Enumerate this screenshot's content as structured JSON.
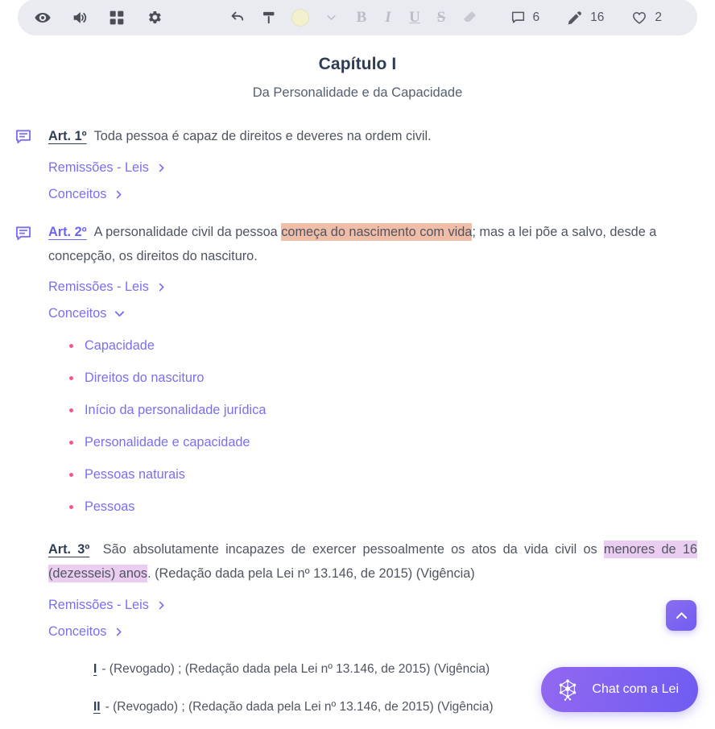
{
  "toolbar": {
    "left_tools": [
      {
        "name": "eye-icon",
        "label": "Visualizar"
      },
      {
        "name": "speaker-icon",
        "label": "Ouvir"
      },
      {
        "name": "grid-icon",
        "label": "Blocos"
      },
      {
        "name": "gear-icon",
        "label": "Configurações"
      }
    ],
    "mid_tools": [
      {
        "name": "undo-icon",
        "label": "Desfazer"
      },
      {
        "name": "paint-roller-icon",
        "label": "Marcador"
      }
    ],
    "color_swatch": {
      "name": "color-swatch",
      "color": "#f2f0cd"
    },
    "format_tools": [
      {
        "name": "bold-button",
        "label": "B"
      },
      {
        "name": "italic-button",
        "label": "I"
      },
      {
        "name": "underline-button",
        "label": "U"
      },
      {
        "name": "strikethrough-button",
        "label": "S"
      },
      {
        "name": "eraser-icon",
        "label": "Apagar"
      }
    ],
    "counters": [
      {
        "name": "comments-counter",
        "icon": "comment-icon",
        "value": "6"
      },
      {
        "name": "highlights-counter",
        "icon": "marker-pen-icon",
        "value": "16"
      },
      {
        "name": "favorites-counter",
        "icon": "heart-icon",
        "value": "2"
      }
    ]
  },
  "document": {
    "chapter_title": "Capítulo I",
    "chapter_subtitle": "Da Personalidade e da Capacidade",
    "articles": [
      {
        "label": "Art. 1º",
        "text": "Toda pessoa é capaz de direitos e deveres na ordem civil.",
        "links": [
          {
            "label": "Remissões - Leis",
            "state": "collapsed"
          },
          {
            "label": "Conceitos",
            "state": "collapsed"
          }
        ]
      },
      {
        "label": "Art. 2º",
        "text_pre": "A personalidade civil da pessoa ",
        "text_highlight": "começa do nascimento com vida",
        "text_post": "; mas a lei põe a salvo, desde a concepção, os direitos do nascituro.",
        "links": [
          {
            "label": "Remissões - Leis",
            "state": "collapsed"
          },
          {
            "label": "Conceitos",
            "state": "expanded"
          }
        ],
        "concepts": [
          "Capacidade",
          "Direitos do nascituro",
          "Início da personalidade jurídica",
          "Personalidade e capacidade",
          "Pessoas naturais",
          "Pessoas"
        ]
      },
      {
        "label": "Art. 3º",
        "text_pre": "São absolutamente incapazes de exercer pessoalmente os atos da vida civil os ",
        "text_highlight": "menores de 16 (dezesseis) anos",
        "text_post": ". (Redação dada pela Lei nº 13.146, de 2015) (Vigência)",
        "links": [
          {
            "label": "Remissões - Leis",
            "state": "collapsed"
          },
          {
            "label": "Conceitos",
            "state": "collapsed"
          }
        ],
        "items": [
          {
            "numeral": "I",
            "text": "- (Revogado) ; (Redação dada pela Lei nº 13.146, de 2015) (Vigência)"
          },
          {
            "numeral": "II",
            "text": "- (Revogado) ; (Redação dada pela Lei nº 13.146, de 2015) (Vigência)"
          }
        ]
      }
    ]
  },
  "floating": {
    "scroll_top": {
      "name": "scroll-to-top-button",
      "icon": "chevron-up-icon"
    },
    "chat": {
      "label": "Chat com a Lei",
      "icon": "network-graph-icon"
    }
  },
  "colors": {
    "accent_purple": "#7a6ff0",
    "highlight_peach": "#f0bda9",
    "highlight_violet": "#eccdf2",
    "bullet_pink": "#f0588c",
    "heading_navy": "#2f3d54"
  }
}
